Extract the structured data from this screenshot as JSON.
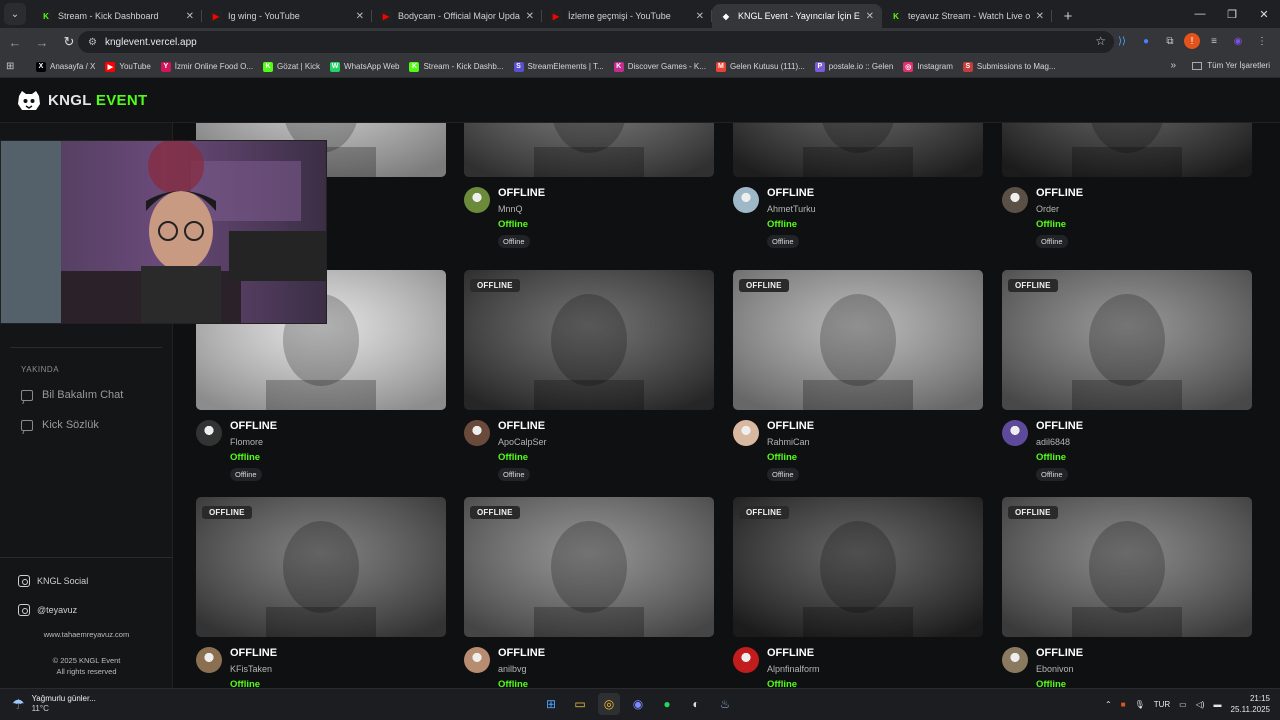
{
  "browser": {
    "tabs": [
      {
        "title": "Stream - Kick Dashboard",
        "fav_color": "#53fc18",
        "fav_glyph": "K",
        "active": false
      },
      {
        "title": "Ig wing - YouTube",
        "fav_color": "#ff0000",
        "fav_glyph": "▶",
        "active": false
      },
      {
        "title": "Bodycam - Official Major Upda",
        "fav_color": "#ff0000",
        "fav_glyph": "▶",
        "active": false
      },
      {
        "title": "İzleme geçmişi - YouTube",
        "fav_color": "#ff0000",
        "fav_glyph": "▶",
        "active": false
      },
      {
        "title": "KNGL Event - Yayıncılar İçin Etk",
        "fav_color": "#ffffff",
        "fav_glyph": "◆",
        "active": true
      },
      {
        "title": "teyavuz Stream - Watch Live on",
        "fav_color": "#53fc18",
        "fav_glyph": "K",
        "active": false
      }
    ],
    "url": "knglevent.vercel.app",
    "bookmarks": [
      {
        "label": "Anasayfa / X",
        "color": "#000000",
        "glyph": "X"
      },
      {
        "label": "YouTube",
        "color": "#ff0000",
        "glyph": "▶"
      },
      {
        "label": "İzmir Online Food O...",
        "color": "#d4145a",
        "glyph": "Y"
      },
      {
        "label": "Gözat | Kick",
        "color": "#53fc18",
        "glyph": "K"
      },
      {
        "label": "WhatsApp Web",
        "color": "#25d366",
        "glyph": "W"
      },
      {
        "label": "Stream - Kick Dashb...",
        "color": "#53fc18",
        "glyph": "K"
      },
      {
        "label": "StreamElements | T...",
        "color": "#5a4fcf",
        "glyph": "S"
      },
      {
        "label": "Discover Games - K...",
        "color": "#c02f8f",
        "glyph": "K"
      },
      {
        "label": "Gelen Kutusu (111)...",
        "color": "#ea4335",
        "glyph": "M"
      },
      {
        "label": "postale.io :: Gelen",
        "color": "#7b5cd6",
        "glyph": "P"
      },
      {
        "label": "Instagram",
        "color": "#e1306c",
        "glyph": "◎"
      },
      {
        "label": "Submissions to Mag...",
        "color": "#c43c3c",
        "glyph": "S"
      }
    ],
    "all_bookmarks": "Tüm Yer İşaretleri"
  },
  "site": {
    "logo_white": "KNGL",
    "logo_green": "EVENT",
    "sidebar": {
      "section": "YAKINDA",
      "items": [
        "Bil Bakalım Chat",
        "Kick Sözlük"
      ],
      "socials": [
        "KNGL Social",
        "@teyavuz"
      ],
      "website": "www.tahaemreyavuz.com",
      "copyright": "© 2025 KNGL Event",
      "rights": "All rights reserved"
    },
    "status_label": "OFFLINE",
    "live_label": "Offline",
    "tag_label": "Offline",
    "streamers": [
      {
        "name": "",
        "theme": "#bdbdbd",
        "av": "#777"
      },
      {
        "name": "MnnQ",
        "theme": "#4a4a4a",
        "av": "#6b8a3a"
      },
      {
        "name": "AhmetTurku",
        "theme": "#2e2e2e",
        "av": "#9fb8c8"
      },
      {
        "name": "Order",
        "theme": "#2a2a2a",
        "av": "#5a5045"
      },
      {
        "name": "Flomore",
        "theme": "#d8d8d8",
        "av": "#333"
      },
      {
        "name": "ApoCalpSer",
        "theme": "#3a3a3a",
        "av": "#6a4a3a"
      },
      {
        "name": "RahmiCan",
        "theme": "#9e9e9e",
        "av": "#d9b8a0"
      },
      {
        "name": "adil6848",
        "theme": "#6e6e6e",
        "av": "#5d4a9a"
      },
      {
        "name": "KFisTaken",
        "theme": "#4e4e4e",
        "av": "#8a7050"
      },
      {
        "name": "anilbvg",
        "theme": "#6a6a6a",
        "av": "#b88c70"
      },
      {
        "name": "Alpnfinalform",
        "theme": "#2a2a2a",
        "av": "#c21d1d"
      },
      {
        "name": "Ebonivon",
        "theme": "#5a5a5a",
        "av": "#8a7a60"
      }
    ]
  },
  "taskbar": {
    "weather_text": "Yağmurlu günler...",
    "temperature": "11°C",
    "language": "TUR",
    "time": "21:15",
    "date": "25.11.2025"
  }
}
